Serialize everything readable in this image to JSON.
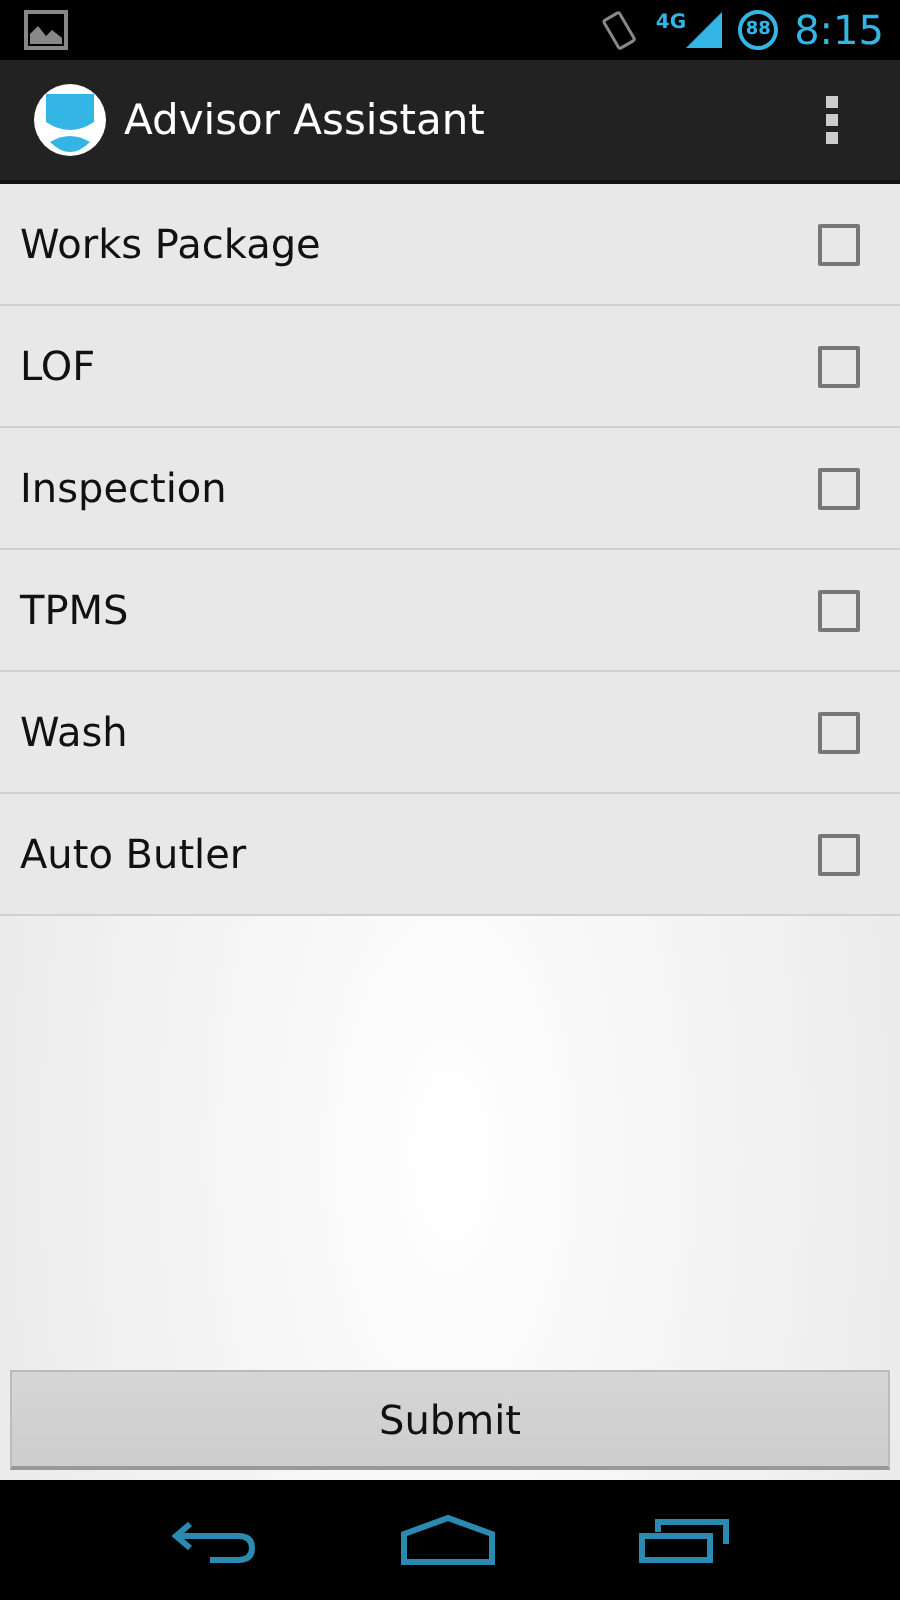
{
  "status_bar": {
    "network": "4G",
    "battery": "88",
    "time": "8:15"
  },
  "action_bar": {
    "title": "Advisor Assistant"
  },
  "items": [
    {
      "label": "Works Package",
      "checked": false
    },
    {
      "label": "LOF",
      "checked": false
    },
    {
      "label": "Inspection",
      "checked": false
    },
    {
      "label": "TPMS",
      "checked": false
    },
    {
      "label": "Wash",
      "checked": false
    },
    {
      "label": "Auto Butler",
      "checked": false
    }
  ],
  "submit": "Submit"
}
